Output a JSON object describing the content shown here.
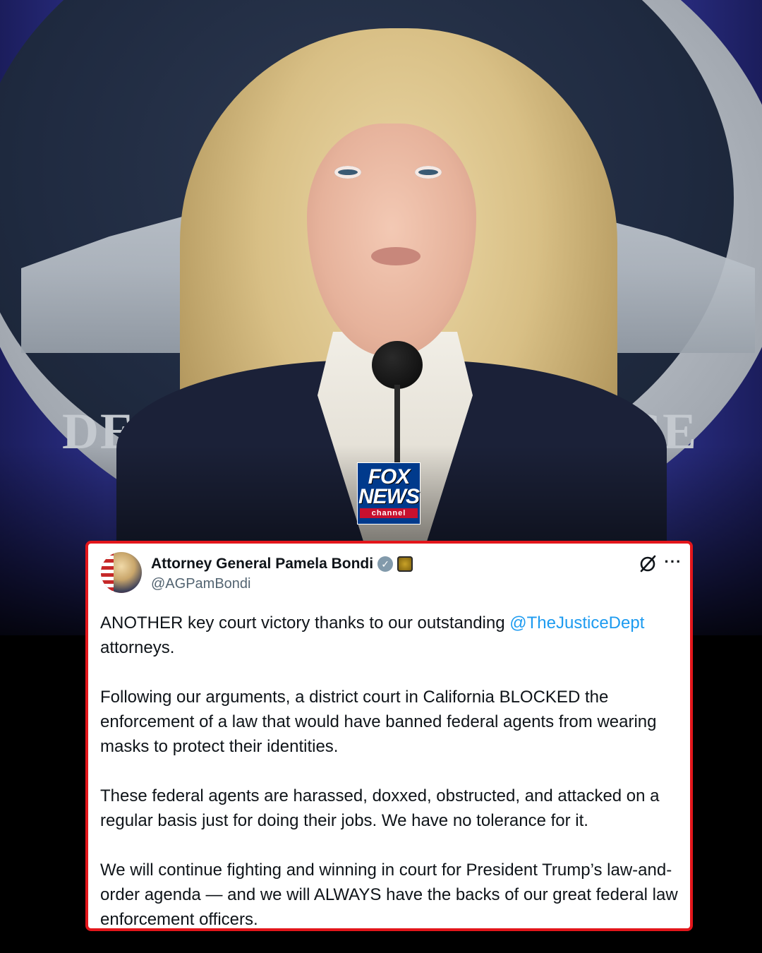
{
  "photo": {
    "seal_left_text": "DE",
    "seal_right_text": "CE"
  },
  "logo": {
    "brand_line1": "FOX",
    "brand_line2": "NEWS",
    "brand_line3": "channel"
  },
  "tweet": {
    "author_name": "Attorney General Pamela Bondi",
    "handle": "@AGPamBondi",
    "verified_icon": "verified-badge-icon",
    "affiliation_icon": "doj-seal-icon",
    "paragraphs": [
      {
        "before": "ANOTHER key court victory thanks to our outstanding ",
        "mention": "@TheJusticeDept",
        "after": " attorneys."
      },
      {
        "text": "Following our arguments, a district court in California BLOCKED the enforcement of a law that would have banned federal agents from wearing masks to protect their identities."
      },
      {
        "text": "These federal agents are harassed, doxxed, obstructed, and attacked on a regular basis just for doing their jobs. We have no tolerance for it."
      },
      {
        "text": "We will continue fighting and winning in court for President Trump’s law-and-order agenda — and we will ALWAYS have the backs of our great federal law enforcement officers."
      }
    ],
    "more_label": "···"
  },
  "colors": {
    "card_border": "#e3161b",
    "mention": "#1d9bf0",
    "fox_blue": "#003a8c",
    "fox_red": "#c8102e"
  }
}
